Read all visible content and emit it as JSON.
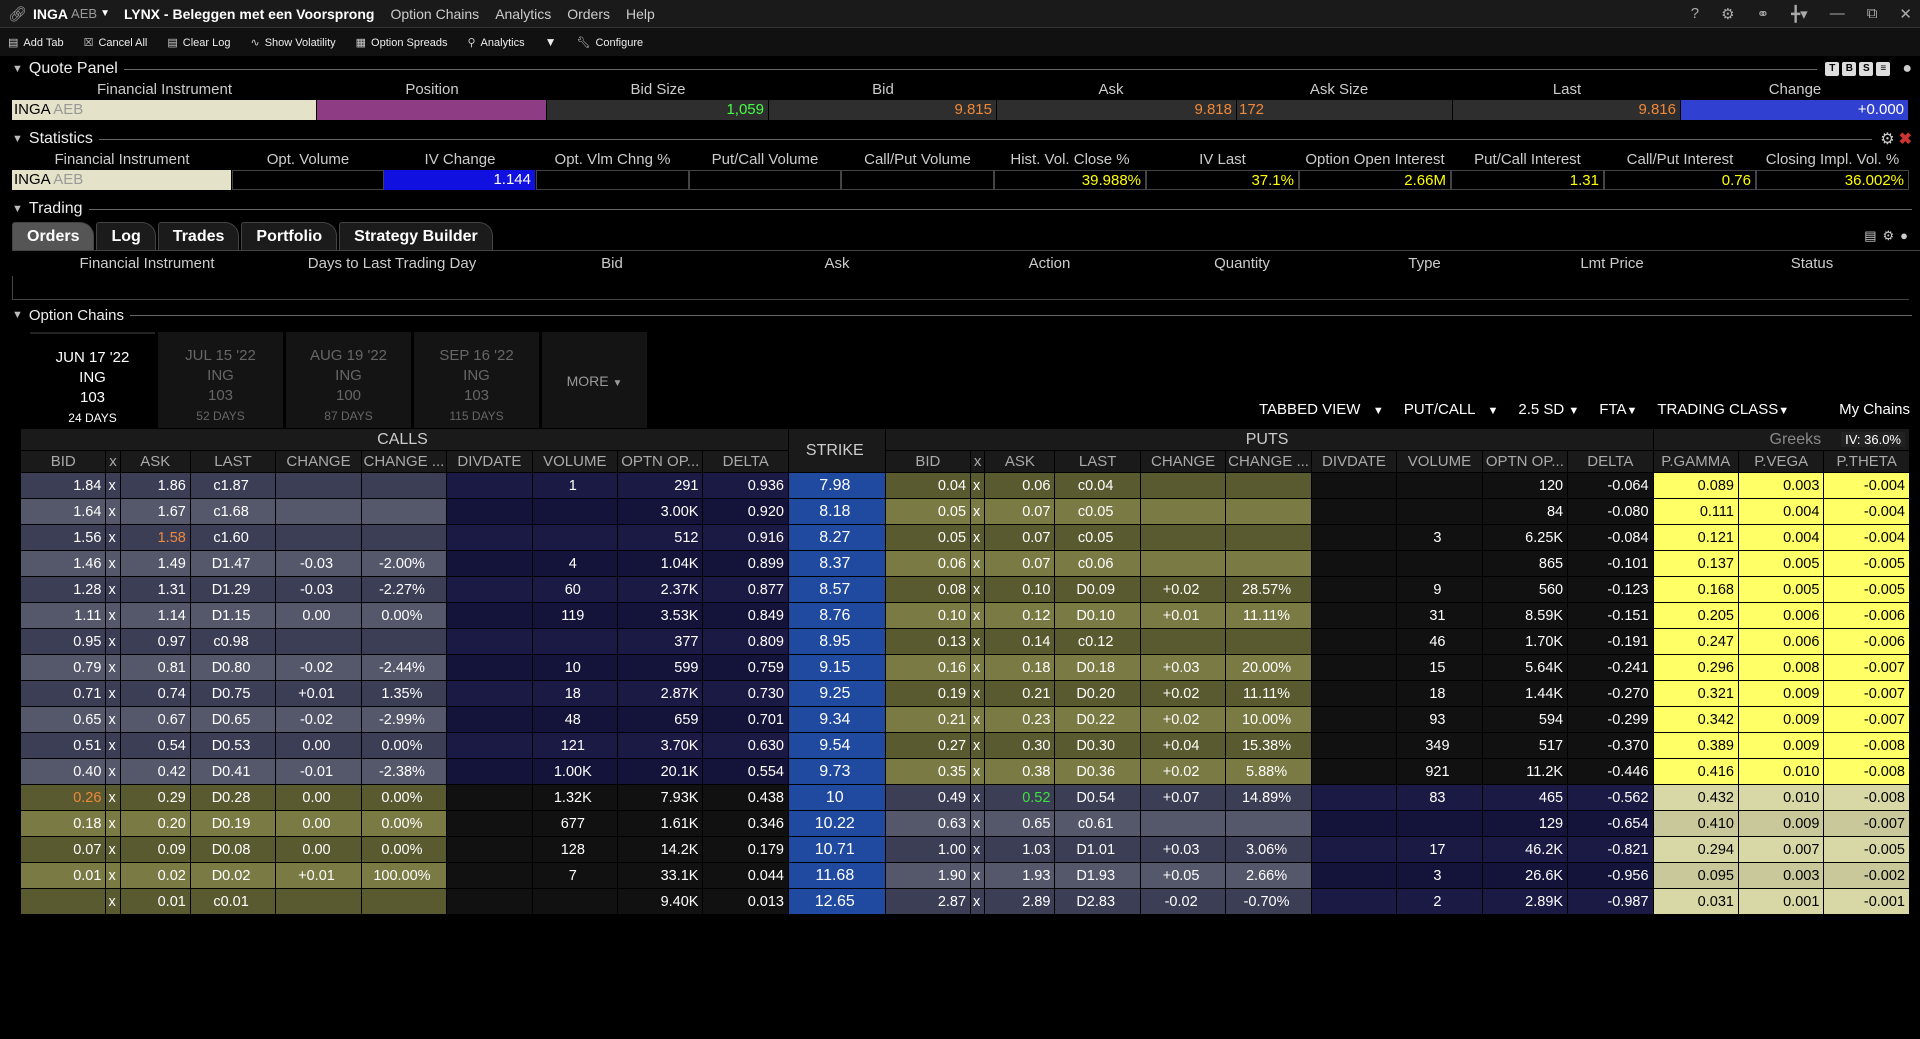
{
  "window": {
    "symbol": "INGA",
    "exchange": "AEB",
    "title": "LYNX - Beleggen met een Voorsprong",
    "menu": [
      "Option Chains",
      "Analytics",
      "Orders",
      "Help"
    ]
  },
  "toolbar": [
    "Add Tab",
    "Cancel All",
    "Clear Log",
    "Show Volatility",
    "Option Spreads",
    "Analytics",
    "Configure"
  ],
  "quote_panel": {
    "title": "Quote Panel",
    "headers": [
      "Financial Instrument",
      "Position",
      "Bid Size",
      "Bid",
      "Ask",
      "Ask Size",
      "Last",
      "Change"
    ],
    "instrument": "INGA",
    "exchange": "AEB",
    "position": "",
    "bid_size": "1,059",
    "bid": "9.815",
    "ask": "9.818",
    "ask_size": "172",
    "last": "9.816",
    "change": "+0.000"
  },
  "statistics": {
    "title": "Statistics",
    "headers": [
      "Financial Instrument",
      "Opt. Volume",
      "IV Change",
      "Opt. Vlm Chng %",
      "Put/Call Volume",
      "Call/Put Volume",
      "Hist. Vol. Close %",
      "IV Last",
      "Option Open Interest",
      "Put/Call Interest",
      "Call/Put Interest",
      "Closing Impl. Vol. %"
    ],
    "instrument": "INGA",
    "exchange": "AEB",
    "values": [
      "",
      "1.144",
      "",
      "",
      "",
      "39.988%",
      "37.1%",
      "2.66M",
      "1.31",
      "0.76",
      "36.002%"
    ]
  },
  "trading": {
    "title": "Trading",
    "tabs": [
      "Orders",
      "Log",
      "Trades",
      "Portfolio",
      "Strategy Builder"
    ],
    "order_headers": [
      "Financial Instrument",
      "Days to Last Trading Day",
      "Bid",
      "Ask",
      "Action",
      "Quantity",
      "Type",
      "Lmt Price",
      "Status"
    ]
  },
  "option_chains": {
    "title": "Option Chains",
    "expiries": [
      {
        "date": "JUN 17 '22",
        "sym": "ING",
        "mult": "103",
        "days": "24 DAYS"
      },
      {
        "date": "JUL 15 '22",
        "sym": "ING",
        "mult": "103",
        "days": "52 DAYS"
      },
      {
        "date": "AUG 19 '22",
        "sym": "ING",
        "mult": "100",
        "days": "87 DAYS"
      },
      {
        "date": "SEP 16 '22",
        "sym": "ING",
        "mult": "103",
        "days": "115 DAYS"
      }
    ],
    "more": "MORE",
    "controls": [
      "TABBED VIEW",
      "PUT/CALL",
      "2.5 SD",
      "FTA",
      "TRADING CLASS",
      "My Chains"
    ],
    "greeks_label": "Greeks",
    "iv_label": "IV: 36.0%",
    "calls_label": "CALLS",
    "puts_label": "PUTS",
    "strike_label": "STRIKE",
    "columns": [
      "BID",
      "x",
      "ASK",
      "LAST",
      "CHANGE",
      "CHANGE ...",
      "DIVDATE",
      "VOLUME",
      "OPTN OP...",
      "DELTA",
      "STRIKE",
      "BID",
      "x",
      "ASK",
      "LAST",
      "CHANGE",
      "CHANGE ...",
      "DIVDATE",
      "VOLUME",
      "OPTN OP...",
      "DELTA",
      "P.GAMMA",
      "P.VEGA",
      "P.THETA"
    ],
    "rows": [
      [
        "1.84",
        "x",
        "1.86",
        "c1.87",
        "",
        "",
        "",
        "1",
        "291",
        "0.936",
        "7.98",
        "0.04",
        "x",
        "0.06",
        "c0.04",
        "",
        "",
        "",
        "",
        "120",
        "-0.064",
        "0.089",
        "0.003",
        "-0.004"
      ],
      [
        "1.64",
        "x",
        "1.67",
        "c1.68",
        "",
        "",
        "",
        "",
        "3.00K",
        "0.920",
        "8.18",
        "0.05",
        "x",
        "0.07",
        "c0.05",
        "",
        "",
        "",
        "",
        "84",
        "-0.080",
        "0.111",
        "0.004",
        "-0.004"
      ],
      [
        "1.56",
        "x",
        "1.58",
        "c1.60",
        "",
        "",
        "",
        "",
        "512",
        "0.916",
        "8.27",
        "0.05",
        "x",
        "0.07",
        "c0.05",
        "",
        "",
        "",
        "3",
        "6.25K",
        "-0.084",
        "0.121",
        "0.004",
        "-0.004"
      ],
      [
        "1.46",
        "x",
        "1.49",
        "D1.47",
        "-0.03",
        "-2.00%",
        "",
        "4",
        "1.04K",
        "0.899",
        "8.37",
        "0.06",
        "x",
        "0.07",
        "c0.06",
        "",
        "",
        "",
        "",
        "865",
        "-0.101",
        "0.137",
        "0.005",
        "-0.005"
      ],
      [
        "1.28",
        "x",
        "1.31",
        "D1.29",
        "-0.03",
        "-2.27%",
        "",
        "60",
        "2.37K",
        "0.877",
        "8.57",
        "0.08",
        "x",
        "0.10",
        "D0.09",
        "+0.02",
        "28.57%",
        "",
        "9",
        "560",
        "-0.123",
        "0.168",
        "0.005",
        "-0.005"
      ],
      [
        "1.11",
        "x",
        "1.14",
        "D1.15",
        "0.00",
        "0.00%",
        "",
        "119",
        "3.53K",
        "0.849",
        "8.76",
        "0.10",
        "x",
        "0.12",
        "D0.10",
        "+0.01",
        "11.11%",
        "",
        "31",
        "8.59K",
        "-0.151",
        "0.205",
        "0.006",
        "-0.006"
      ],
      [
        "0.95",
        "x",
        "0.97",
        "c0.98",
        "",
        "",
        "",
        "",
        "377",
        "0.809",
        "8.95",
        "0.13",
        "x",
        "0.14",
        "c0.12",
        "",
        "",
        "",
        "46",
        "1.70K",
        "-0.191",
        "0.247",
        "0.006",
        "-0.006"
      ],
      [
        "0.79",
        "x",
        "0.81",
        "D0.80",
        "-0.02",
        "-2.44%",
        "",
        "10",
        "599",
        "0.759",
        "9.15",
        "0.16",
        "x",
        "0.18",
        "D0.18",
        "+0.03",
        "20.00%",
        "",
        "15",
        "5.64K",
        "-0.241",
        "0.296",
        "0.008",
        "-0.007"
      ],
      [
        "0.71",
        "x",
        "0.74",
        "D0.75",
        "+0.01",
        "1.35%",
        "",
        "18",
        "2.87K",
        "0.730",
        "9.25",
        "0.19",
        "x",
        "0.21",
        "D0.20",
        "+0.02",
        "11.11%",
        "",
        "18",
        "1.44K",
        "-0.270",
        "0.321",
        "0.009",
        "-0.007"
      ],
      [
        "0.65",
        "x",
        "0.67",
        "D0.65",
        "-0.02",
        "-2.99%",
        "",
        "48",
        "659",
        "0.701",
        "9.34",
        "0.21",
        "x",
        "0.23",
        "D0.22",
        "+0.02",
        "10.00%",
        "",
        "93",
        "594",
        "-0.299",
        "0.342",
        "0.009",
        "-0.007"
      ],
      [
        "0.51",
        "x",
        "0.54",
        "D0.53",
        "0.00",
        "0.00%",
        "",
        "121",
        "3.70K",
        "0.630",
        "9.54",
        "0.27",
        "x",
        "0.30",
        "D0.30",
        "+0.04",
        "15.38%",
        "",
        "349",
        "517",
        "-0.370",
        "0.389",
        "0.009",
        "-0.008"
      ],
      [
        "0.40",
        "x",
        "0.42",
        "D0.41",
        "-0.01",
        "-2.38%",
        "",
        "1.00K",
        "20.1K",
        "0.554",
        "9.73",
        "0.35",
        "x",
        "0.38",
        "D0.36",
        "+0.02",
        "5.88%",
        "",
        "921",
        "11.2K",
        "-0.446",
        "0.416",
        "0.010",
        "-0.008"
      ],
      [
        "0.26",
        "x",
        "0.29",
        "D0.28",
        "0.00",
        "0.00%",
        "",
        "1.32K",
        "7.93K",
        "0.438",
        "10",
        "0.49",
        "x",
        "0.52",
        "D0.54",
        "+0.07",
        "14.89%",
        "",
        "83",
        "465",
        "-0.562",
        "0.432",
        "0.010",
        "-0.008"
      ],
      [
        "0.18",
        "x",
        "0.20",
        "D0.19",
        "0.00",
        "0.00%",
        "",
        "677",
        "1.61K",
        "0.346",
        "10.22",
        "0.63",
        "x",
        "0.65",
        "c0.61",
        "",
        "",
        "",
        "",
        "129",
        "-0.654",
        "0.410",
        "0.009",
        "-0.007"
      ],
      [
        "0.07",
        "x",
        "0.09",
        "D0.08",
        "0.00",
        "0.00%",
        "",
        "128",
        "14.2K",
        "0.179",
        "10.71",
        "1.00",
        "x",
        "1.03",
        "D1.01",
        "+0.03",
        "3.06%",
        "",
        "17",
        "46.2K",
        "-0.821",
        "0.294",
        "0.007",
        "-0.005"
      ],
      [
        "0.01",
        "x",
        "0.02",
        "D0.02",
        "+0.01",
        "100.00%",
        "",
        "7",
        "33.1K",
        "0.044",
        "11.68",
        "1.90",
        "x",
        "1.93",
        "D1.93",
        "+0.05",
        "2.66%",
        "",
        "3",
        "26.6K",
        "-0.956",
        "0.095",
        "0.003",
        "-0.002"
      ],
      [
        "",
        "x",
        "0.01",
        "c0.01",
        "",
        "",
        "",
        "",
        "9.40K",
        "0.013",
        "12.65",
        "2.87",
        "x",
        "2.89",
        "D2.83",
        "-0.02",
        "-0.70%",
        "",
        "2",
        "2.89K",
        "-0.987",
        "0.031",
        "0.001",
        "-0.001"
      ]
    ]
  }
}
